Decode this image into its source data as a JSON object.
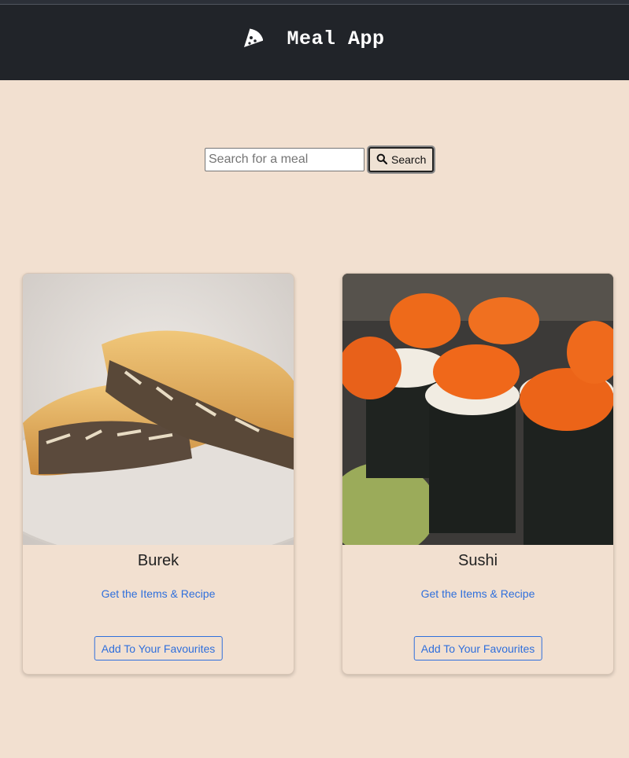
{
  "header": {
    "logo_icon": "pizza-slice-icon",
    "title": "Meal App",
    "background": "#212429"
  },
  "search": {
    "placeholder": "Search for a meal",
    "value": "",
    "button_label": "Search",
    "button_icon": "search-icon"
  },
  "meals": [
    {
      "name": "Burek",
      "recipe_link": "Get the Items & Recipe",
      "favourite_label": "Add To Your Favourites",
      "image": "burek-photo"
    },
    {
      "name": "Sushi",
      "recipe_link": "Get the Items & Recipe",
      "favourite_label": "Add To Your Favourites",
      "image": "sushi-photo"
    }
  ],
  "colors": {
    "page_background": "#f2e0d0",
    "link": "#2f6fdc"
  }
}
